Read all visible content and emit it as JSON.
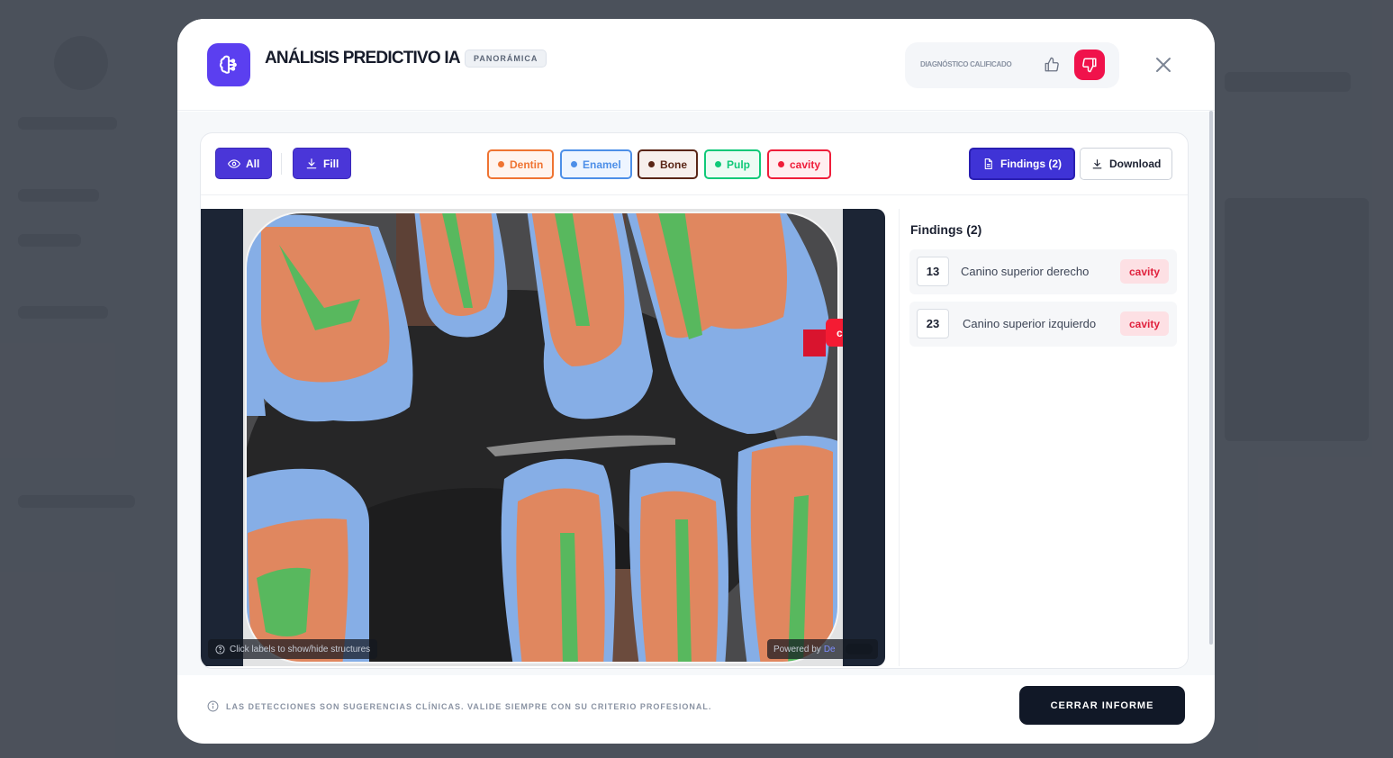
{
  "header": {
    "title": "ANÁLISIS PREDICTIVO IA",
    "badge": "PANORÁMICA",
    "rating_label": "DIAGNÓSTICO CALIFICADO",
    "icons": {
      "logo": "brain-icon",
      "thumb_up": "thumb-up-icon",
      "thumb_down": "thumb-down-icon",
      "close": "close-icon"
    }
  },
  "toolbar": {
    "all_label": "All",
    "fill_label": "Fill",
    "chips": [
      {
        "label": "Dentin",
        "color": "#ef7432",
        "bg": "#fff4ee"
      },
      {
        "label": "Enamel",
        "color": "#4d8fe8",
        "bg": "#eef5ff"
      },
      {
        "label": "Bone",
        "color": "#5a2516",
        "bg": "#f7efec"
      },
      {
        "label": "Pulp",
        "color": "#10c979",
        "bg": "#edfbf4"
      },
      {
        "label": "cavity",
        "color": "#ef1d3a",
        "bg": "#ffeef0"
      }
    ],
    "findings_label": "Findings (2)",
    "download_label": "Download"
  },
  "viewer": {
    "hint": "Click labels to show/hide structures",
    "powered_by": "Powered by",
    "powered_brand": "De",
    "cavity_label": "cavity"
  },
  "findings": {
    "title": "Findings (2)",
    "items": [
      {
        "tooth": "13",
        "name": "Canino superior derecho",
        "label": "cavity"
      },
      {
        "tooth": "23",
        "name": "Canino superior izquierdo",
        "label": "cavity"
      }
    ]
  },
  "footer": {
    "note": "LAS DETECCIONES SON SUGERENCIAS CLÍNICAS. VALIDE SIEMPRE CON SU CRITERIO PROFESIONAL.",
    "close_label": "CERRAR INFORME"
  },
  "colors": {
    "accent": "#4a36d8",
    "danger": "#f0124b",
    "dentin_fill": "#e0875f",
    "enamel_fill": "#86aee6",
    "pulp_fill": "#58b85e",
    "bone_fill": "#6e4a3c"
  }
}
